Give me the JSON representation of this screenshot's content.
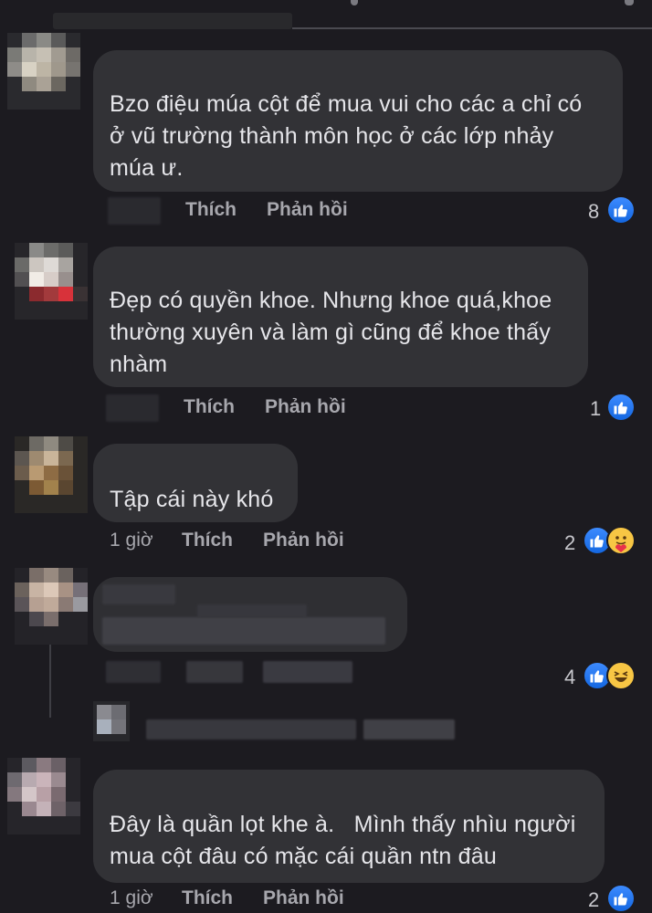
{
  "comments": [
    {
      "text_lines": [
        "Bzo điệu múa cột để mua vui cho các a chỉ có",
        "ở vũ trường thành môn học ở các lớp nhảy",
        "múa ư."
      ],
      "time": "",
      "like": "Thích",
      "reply": "Phản hồi",
      "reaction_count": "8"
    },
    {
      "text_lines": [
        "Đẹp có quyền khoe. Nhưng khoe quá,khoe",
        "thường xuyên và làm gì cũng để khoe thấy",
        "nhàm"
      ],
      "time": "",
      "like": "Thích",
      "reply": "Phản hồi",
      "reaction_count": "1"
    },
    {
      "text_lines": [
        "Tập cái này khó"
      ],
      "time": "1 giờ",
      "like": "Thích",
      "reply": "Phản hồi",
      "reaction_count": "2"
    },
    {
      "text_lines": [],
      "time": "",
      "like": "",
      "reply": "",
      "reaction_count": "4"
    },
    {
      "text_lines": [
        "Đây là quần lọt khe à.   Mình thấy nhìu người",
        "mua cột đâu có mặc cái quần ntn đâu"
      ],
      "time": "1 giờ",
      "like": "Thích",
      "reply": "Phản hồi",
      "reaction_count": "2"
    }
  ],
  "colors": {
    "background": "#1c1b20",
    "bubble": "#323236",
    "text": "#e6e6ea",
    "action_text": "#a7a7ad",
    "like_blue": "#1b74e4",
    "emoji_yellow": "#f7c644"
  },
  "icons": [
    "like-icon",
    "care-icon",
    "haha-icon"
  ]
}
